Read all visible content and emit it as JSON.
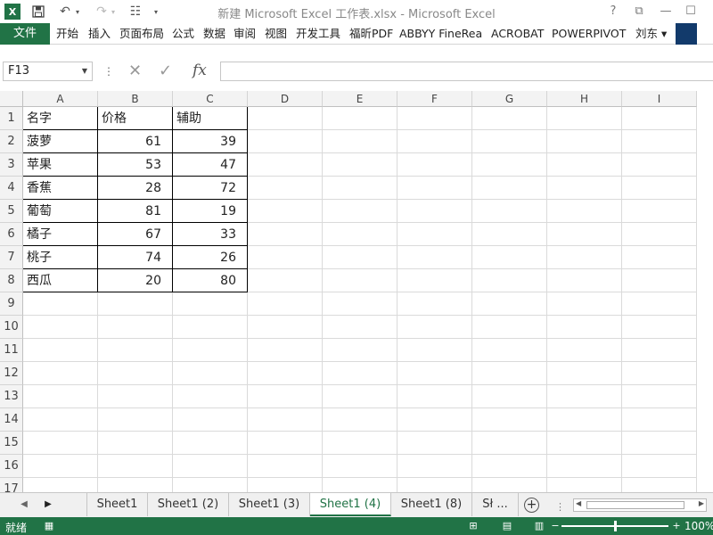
{
  "window": {
    "title": "新建 Microsoft Excel 工作表.xlsx - Microsoft Excel",
    "help": "?",
    "min": "—",
    "max": "☐",
    "restore": "⧉"
  },
  "ribbon": {
    "file_label": "文件",
    "tabs": [
      "开始",
      "插入",
      "页面布局",
      "公式",
      "数据",
      "审阅",
      "视图",
      "开发工具",
      "福昕PDF",
      "ABBYY FineRea",
      "ACROBAT",
      "POWERPIVOT",
      "刘东 ▾"
    ]
  },
  "formula_bar": {
    "name_box": "F13",
    "formula": "",
    "fx": "fx",
    "cancel": "✕",
    "confirm": "✓"
  },
  "columns": [
    "A",
    "B",
    "C",
    "D",
    "E",
    "F",
    "G",
    "H",
    "I"
  ],
  "rows": [
    "1",
    "2",
    "3",
    "4",
    "5",
    "6",
    "7",
    "8",
    "9",
    "10",
    "11",
    "12",
    "13",
    "14",
    "15",
    "16",
    "17"
  ],
  "table": {
    "header": [
      "名字",
      "价格",
      "辅助"
    ],
    "rows": [
      [
        "菠萝",
        "61",
        "39"
      ],
      [
        "苹果",
        "53",
        "47"
      ],
      [
        "香蕉",
        "28",
        "72"
      ],
      [
        "葡萄",
        "81",
        "19"
      ],
      [
        "橘子",
        "67",
        "33"
      ],
      [
        "桃子",
        "74",
        "26"
      ],
      [
        "西瓜",
        "20",
        "80"
      ]
    ]
  },
  "sheets": {
    "tabs": [
      "Sheet1",
      "Sheet1 (2)",
      "Sheet1 (3)",
      "Sheet1 (4)",
      "Sheet1 (8)",
      "Sł ..."
    ],
    "active_index": 3,
    "add": "+"
  },
  "status": {
    "ready": "就绪",
    "zoom": "100%",
    "zoom_level": 1.0
  }
}
